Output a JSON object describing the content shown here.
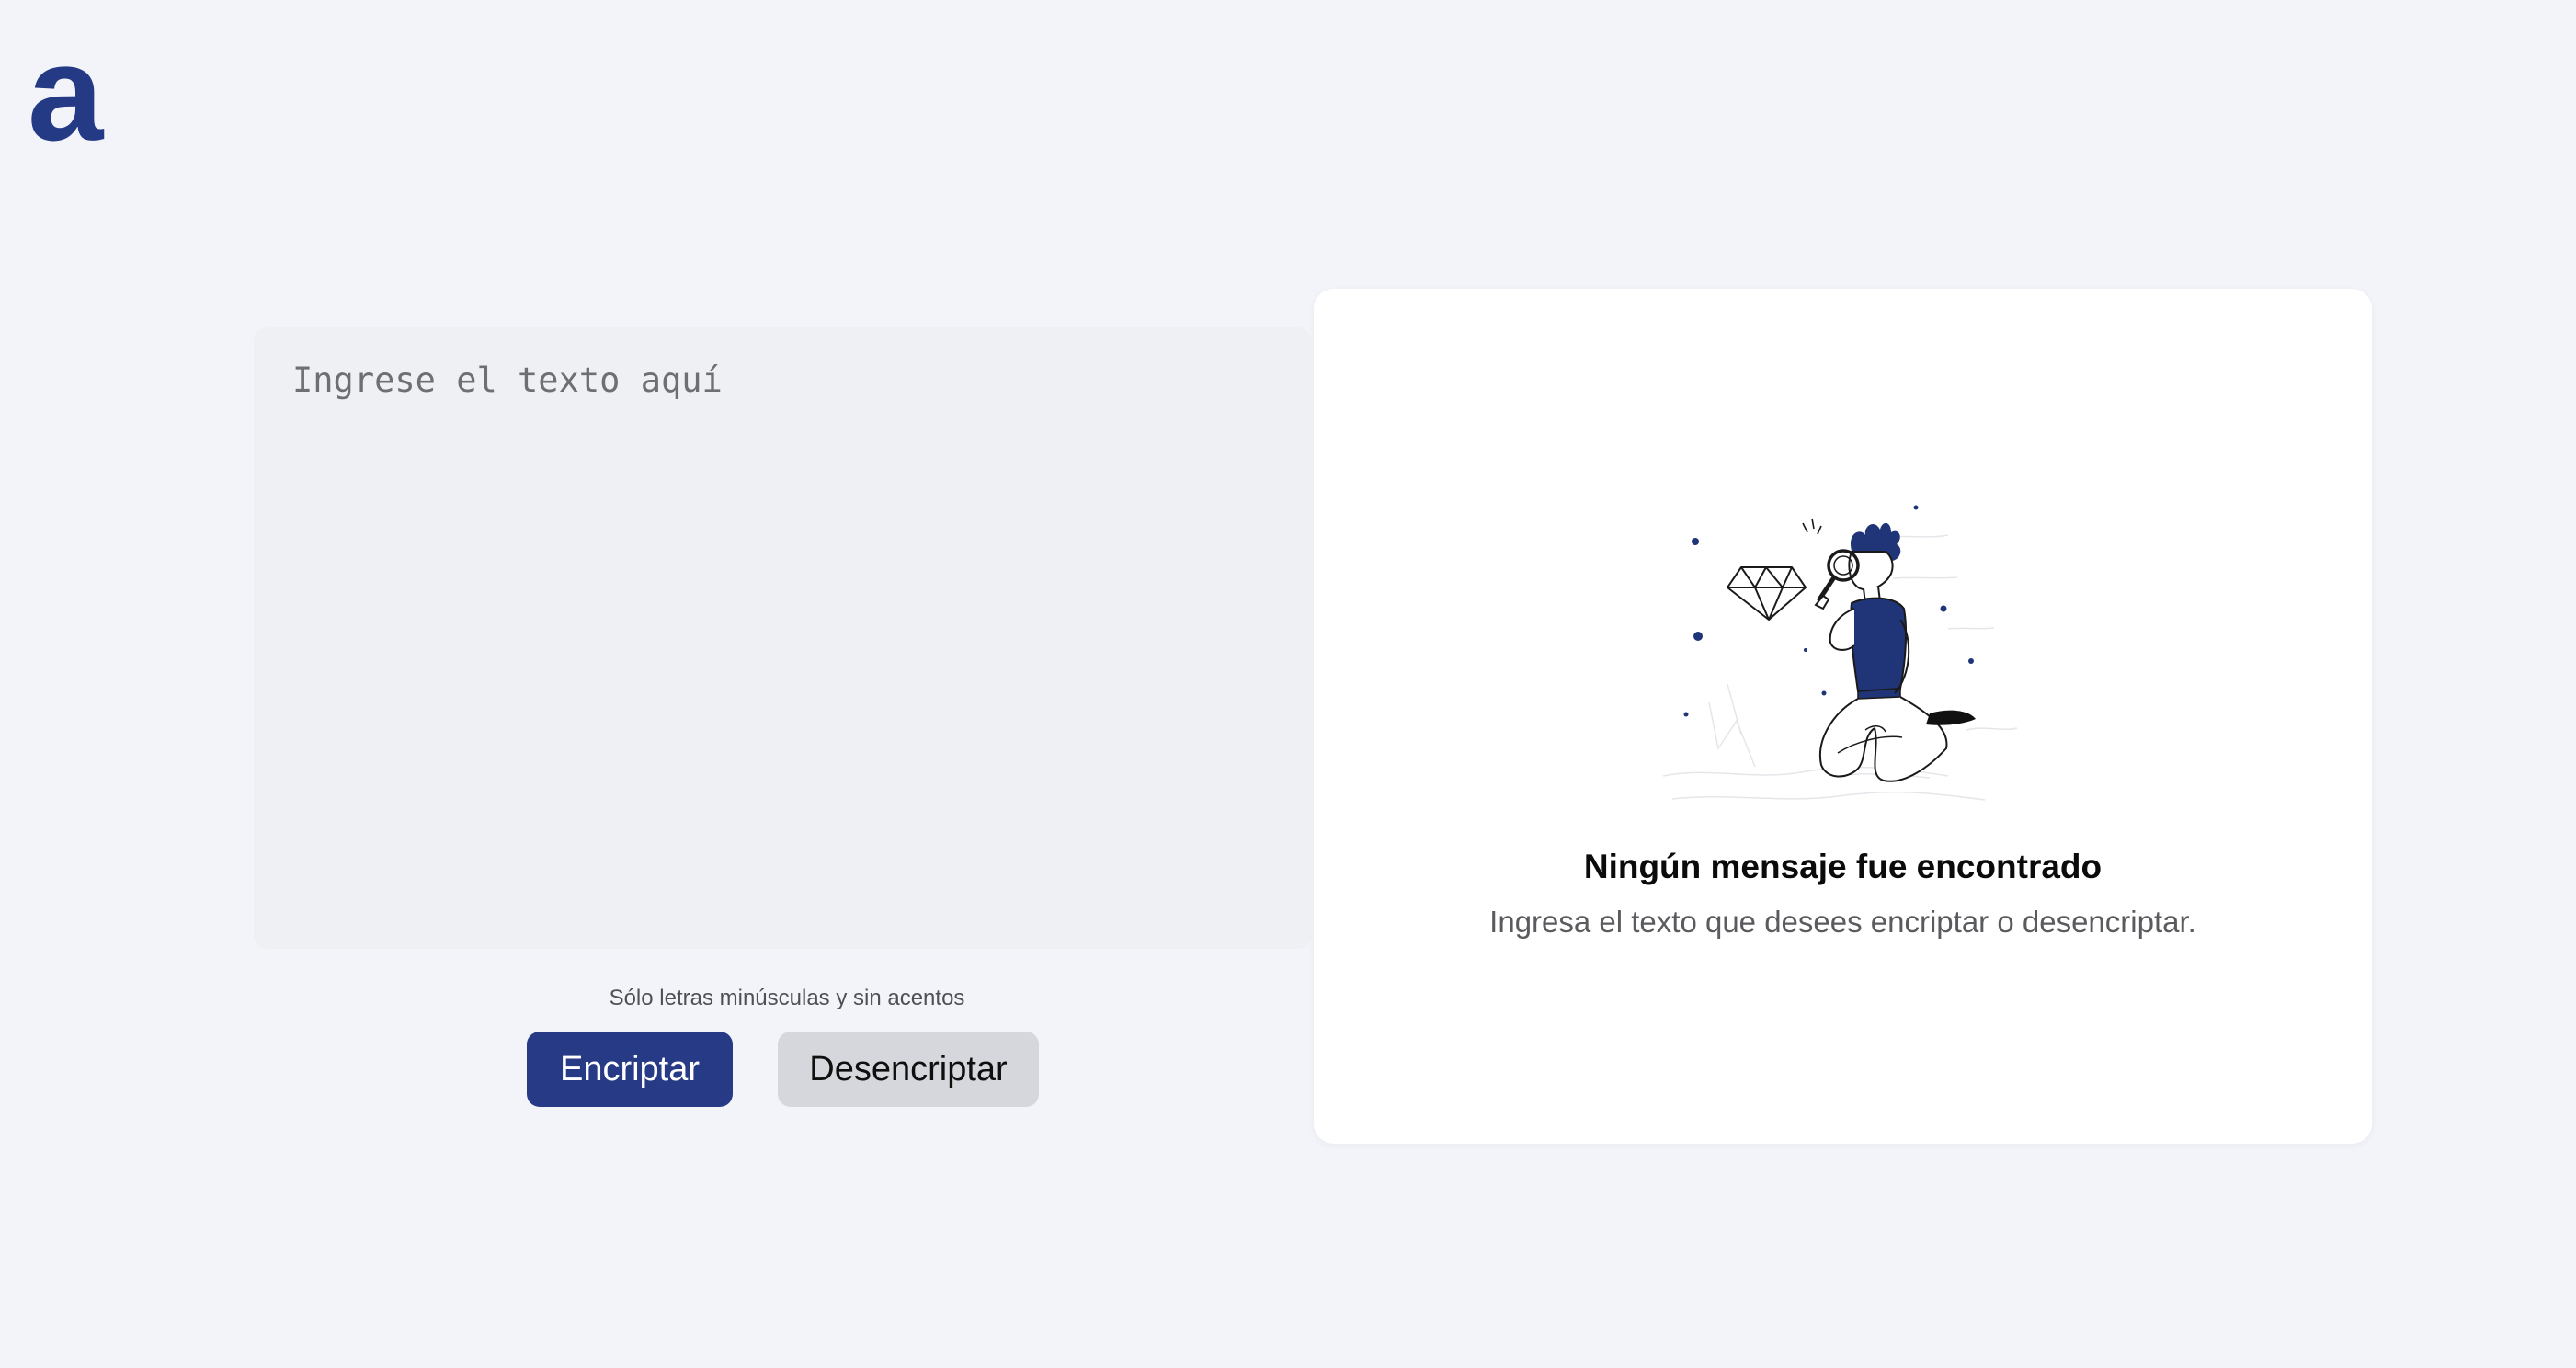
{
  "brand": {
    "logo_text": "a",
    "accent_color": "#253a85"
  },
  "input": {
    "placeholder": "Ingrese el texto aquí",
    "value": ""
  },
  "hint": {
    "icon": "info-icon",
    "text": "Sólo letras minúsculas y sin acentos"
  },
  "buttons": {
    "encrypt_label": "Encriptar",
    "decrypt_label": "Desencriptar"
  },
  "result": {
    "illustration": "person-with-magnifying-glass-illustration",
    "title": "Ningún mensaje fue encontrado",
    "subtitle": "Ingresa el texto que desees encriptar o desencriptar."
  }
}
